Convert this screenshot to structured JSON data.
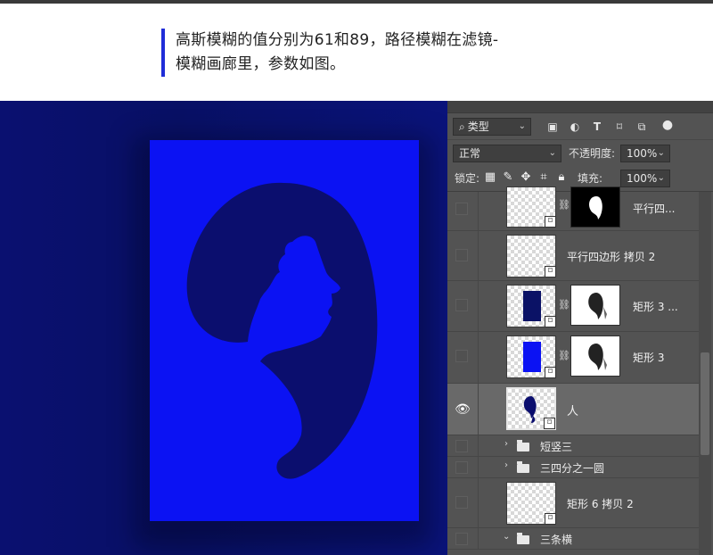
{
  "caption": {
    "line1": "高斯模糊的值分别为61和89，路径模糊在滤镜-",
    "line2": "模糊画廊里，参数如图。"
  },
  "colors": {
    "artboard_fill": "#0b12f3",
    "canvas_bg": "#0a1070",
    "figure_fill": "#0b0e6e",
    "panel_bg": "#535353",
    "accent_bar": "#1f2dd8"
  },
  "panel": {
    "filter": {
      "search_icon": "search-icon",
      "kind": "类型"
    },
    "blend_mode": "正常",
    "opacity_label": "不透明度:",
    "opacity_value": "100%",
    "lock_label": "锁定:",
    "fill_label": "填充:",
    "fill_value": "100%",
    "layers": [
      {
        "name": "平行四...",
        "visible": false,
        "has_mask": true,
        "mask_style": "black"
      },
      {
        "name": "平行四边形 拷贝 2",
        "visible": false,
        "has_mask": false
      },
      {
        "name": "矩形 3 ...",
        "visible": false,
        "has_mask": true,
        "thumb_color": "#0b1266"
      },
      {
        "name": "矩形 3",
        "visible": false,
        "has_mask": true,
        "thumb_color": "#0b12f3"
      },
      {
        "name": "人",
        "visible": true,
        "selected": true,
        "has_mask": false
      },
      {
        "name": "短竖三",
        "type": "group",
        "expanded": false
      },
      {
        "name": "三四分之一圆",
        "type": "group",
        "expanded": false
      },
      {
        "name": "矩形 6 拷贝 2",
        "visible": false,
        "has_mask": false
      },
      {
        "name": "三条横",
        "type": "group",
        "expanded": true
      }
    ]
  }
}
